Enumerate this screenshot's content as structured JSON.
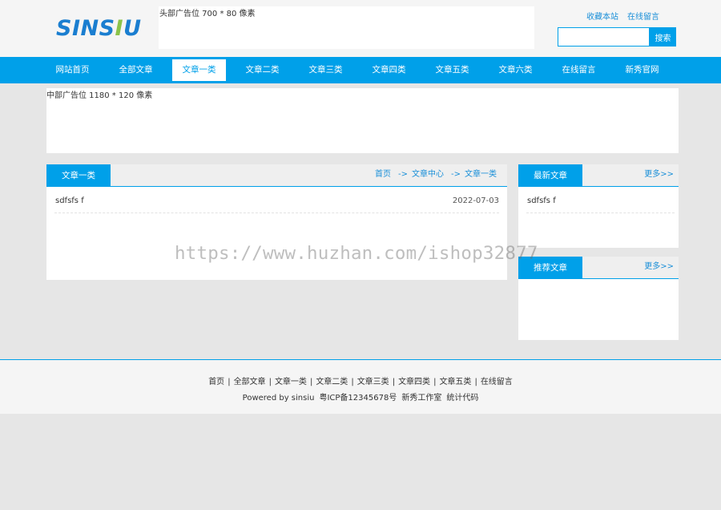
{
  "header": {
    "logo_part1": "SINS",
    "logo_part2": "I",
    "logo_part3": "U",
    "top_ad_text": "头部广告位 700 * 80 像素",
    "links": [
      "收藏本站",
      "在线留言"
    ],
    "search_button": "搜索",
    "search_value": ""
  },
  "nav": {
    "items": [
      "网站首页",
      "全部文章",
      "文章一类",
      "文章二类",
      "文章三类",
      "文章四类",
      "文章五类",
      "文章六类",
      "在线留言",
      "新秀官网"
    ],
    "active": "文章一类"
  },
  "mid_ad_text": "中部广告位 1180 * 120 像素",
  "main_panel": {
    "title": "文章一类",
    "breadcrumb": [
      "首页",
      "文章中心",
      "文章一类"
    ],
    "breadcrumb_sep": "->",
    "articles": [
      {
        "title": "sdfsfs f",
        "date": "2022-07-03"
      }
    ]
  },
  "latest_panel": {
    "title": "最新文章",
    "more": "更多>>",
    "articles": [
      {
        "title": "sdfsfs f"
      }
    ]
  },
  "recommend_panel": {
    "title": "推荐文章",
    "more": "更多>>"
  },
  "footer": {
    "links": [
      "首页",
      "全部文章",
      "文章一类",
      "文章二类",
      "文章三类",
      "文章四类",
      "文章五类",
      "在线留言"
    ],
    "copyright": [
      "Powered by sinsiu",
      "粤ICP备12345678号",
      "新秀工作室",
      "统计代码"
    ]
  },
  "watermark": "https://www.huzhan.com/ishop32877",
  "colors": {
    "accent": "#00a0e9",
    "link": "#1a8fd8",
    "logo_blue": "#1a7ed0",
    "logo_green": "#8bc34a"
  }
}
